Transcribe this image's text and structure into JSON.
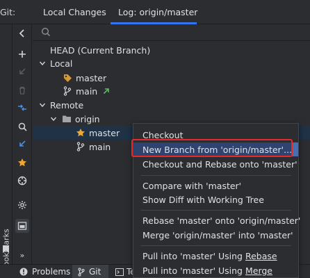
{
  "topbar": {
    "label": "Git:",
    "tabs": [
      {
        "label": "Local Changes"
      },
      {
        "label": "Log: origin/master"
      }
    ]
  },
  "rail": {
    "bookmarks_label": "Bookmarks"
  },
  "tree": {
    "head": "HEAD (Current Branch)",
    "local_label": "Local",
    "local_master": "master",
    "local_main": "main",
    "remote_label": "Remote",
    "origin_label": "origin",
    "origin_master": "master",
    "origin_main": "main"
  },
  "menu": {
    "checkout": "Checkout",
    "new_branch": "New Branch from 'origin/master'...",
    "checkout_rebase": "Checkout and Rebase onto 'master'",
    "compare": "Compare with 'master'",
    "show_diff": "Show Diff with Working Tree",
    "rebase": "Rebase 'master' onto 'origin/master'",
    "merge": "Merge 'origin/master' into 'master'",
    "pull_rebase_prefix": "Pull into 'master' Using ",
    "pull_rebase_key": "Rebase",
    "pull_merge_prefix": "Pull into 'master' Using ",
    "pull_merge_key": "Merge"
  },
  "bottombar": {
    "problems": "Problems",
    "git": "Git",
    "terminal_partial": "Te"
  },
  "colors": {
    "accent": "#3574f0",
    "selection": "#1f3246",
    "menu_highlight": "#2e436e",
    "annotation_box": "#e5292b",
    "tag_orange": "#d09a3a",
    "star": "#f0a732",
    "arrow_green": "#5fb865"
  }
}
